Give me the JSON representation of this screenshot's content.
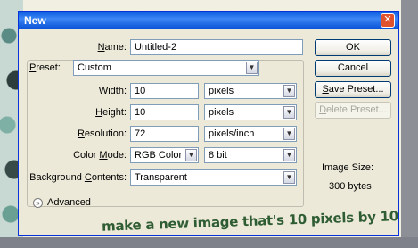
{
  "window": {
    "title": "New",
    "close_glyph": "✕"
  },
  "labels": {
    "name": "Name:",
    "preset": "Preset:",
    "width": "Width:",
    "height": "Height:",
    "resolution": "Resolution:",
    "color_mode": "Color Mode:",
    "background_contents": "Background Contents:",
    "advanced": "Advanced",
    "image_size": "Image Size:"
  },
  "fields": {
    "name": "Untitled-2",
    "preset": "Custom",
    "width": "10",
    "width_unit": "pixels",
    "height": "10",
    "height_unit": "pixels",
    "resolution": "72",
    "resolution_unit": "pixels/inch",
    "color_mode": "RGB Color",
    "bit_depth": "8 bit",
    "background_contents": "Transparent"
  },
  "buttons": {
    "ok": "OK",
    "cancel": "Cancel",
    "save_preset": "Save Preset...",
    "delete_preset": "Delete Preset..."
  },
  "image_size_value": "300 bytes",
  "annotation": "make a new image that's 10 pixels by 10",
  "icons": {
    "dropdown": "chevron-down-icon",
    "advanced_toggle": "double-chevron-down-icon"
  },
  "colors": {
    "titlebar": "#0a5ddf",
    "dialog_bg": "#ece9d8",
    "annotation": "#2f5d33"
  }
}
